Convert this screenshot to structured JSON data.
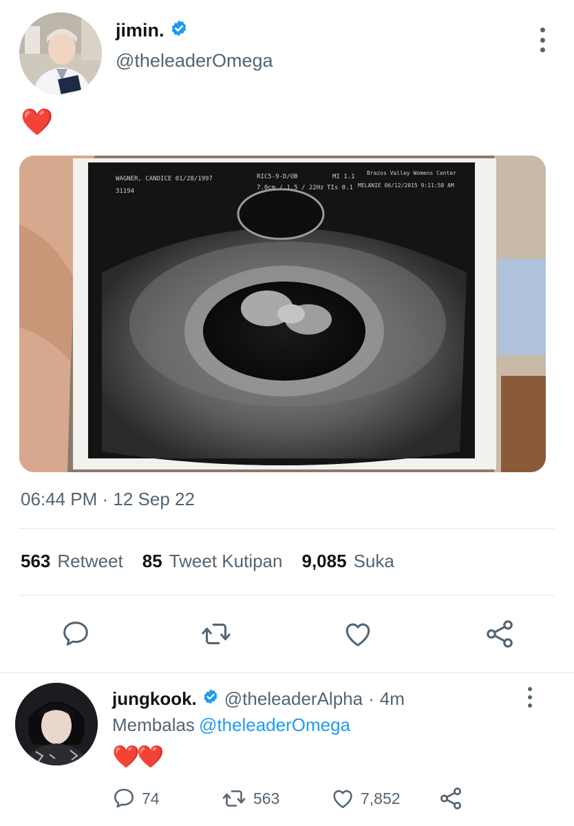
{
  "tweet": {
    "author": {
      "display_name": "jimin.",
      "handle": "@theleaderOmega",
      "verified_icon": "verified-badge-icon",
      "avatar_icon": "user-avatar"
    },
    "text": "❤️",
    "media": {
      "kind": "ultrasound-photo",
      "header_left": "WAGNER, CANDICE 01/28/1997",
      "header_id": "31194",
      "header_mid": "RIC5-9-D/OB",
      "header_mid2": "7.0cm / 1.5 / 22Hz",
      "header_mi": "MI 1.1",
      "header_tis": "TIs 0.1",
      "header_right": "Brazos Valley Womens Center",
      "header_right2": "MELANIE 06/12/2015 9:11:58 AM"
    },
    "timestamp": "06:44 PM · 12 Sep 22",
    "stats": [
      {
        "value": "563",
        "label": "Retweet"
      },
      {
        "value": "85",
        "label": "Tweet Kutipan"
      },
      {
        "value": "9,085",
        "label": "Suka"
      }
    ],
    "actions": [
      "reply-icon",
      "retweet-icon",
      "like-icon",
      "share-icon"
    ]
  },
  "reply": {
    "display_name": "jungkook.",
    "handle": "@theleaderAlpha",
    "separator": "·",
    "time": "4m",
    "replying_label": "Membalas",
    "replying_to": "@theleaderOmega",
    "text": "❤️❤️",
    "counts": {
      "replies": "74",
      "retweets": "563",
      "likes": "7,852"
    }
  },
  "colors": {
    "text_primary": "#0f1419",
    "text_secondary": "#536471",
    "accent": "#1d9bf0",
    "heart": "#e0202e",
    "divider": "#e2e6ea"
  }
}
